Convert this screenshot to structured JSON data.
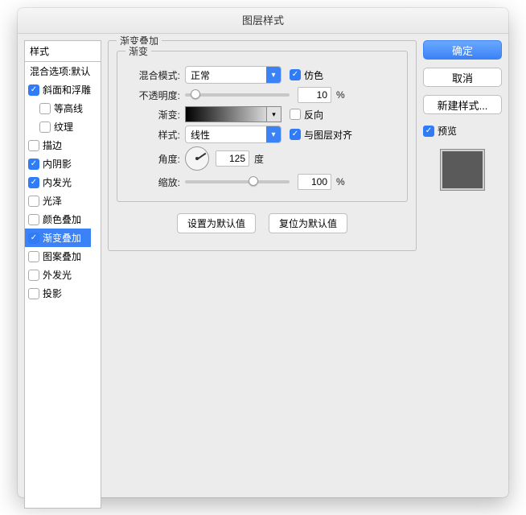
{
  "title": "图层样式",
  "styles_header": "样式",
  "blend_options_label": "混合选项:默认",
  "styles": [
    {
      "key": "bevel",
      "label": "斜面和浮雕",
      "checked": true,
      "indent": false
    },
    {
      "key": "contour",
      "label": "等高线",
      "checked": false,
      "indent": true
    },
    {
      "key": "texture",
      "label": "纹理",
      "checked": false,
      "indent": true
    },
    {
      "key": "stroke",
      "label": "描边",
      "checked": false,
      "indent": false
    },
    {
      "key": "innersh",
      "label": "内阴影",
      "checked": true,
      "indent": false
    },
    {
      "key": "innergl",
      "label": "内发光",
      "checked": true,
      "indent": false
    },
    {
      "key": "satin",
      "label": "光泽",
      "checked": false,
      "indent": false
    },
    {
      "key": "colover",
      "label": "颜色叠加",
      "checked": false,
      "indent": false
    },
    {
      "key": "gradov",
      "label": "渐变叠加",
      "checked": true,
      "indent": false,
      "selected": true
    },
    {
      "key": "patov",
      "label": "图案叠加",
      "checked": false,
      "indent": false
    },
    {
      "key": "outergl",
      "label": "外发光",
      "checked": false,
      "indent": false
    },
    {
      "key": "dropsh",
      "label": "投影",
      "checked": false,
      "indent": false
    }
  ],
  "panel": {
    "legend": "渐变叠加",
    "inner_legend": "渐变",
    "blend_mode_label": "混合模式:",
    "blend_mode_value": "正常",
    "dither_label": "仿色",
    "dither_checked": true,
    "opacity_label": "不透明度:",
    "opacity_value": "10",
    "opacity_unit": "%",
    "opacity_slider_pct": 10,
    "gradient_label": "渐变:",
    "reverse_label": "反向",
    "reverse_checked": false,
    "style_label": "样式:",
    "style_value": "线性",
    "align_label": "与图层对齐",
    "align_checked": true,
    "angle_label": "角度:",
    "angle_value": "125",
    "angle_unit": "度",
    "scale_label": "缩放:",
    "scale_value": "100",
    "scale_unit": "%",
    "scale_slider_pct": 65,
    "default_btn": "设置为默认值",
    "reset_btn": "复位为默认值"
  },
  "right": {
    "ok": "确定",
    "cancel": "取消",
    "new_style": "新建样式...",
    "preview_label": "预览",
    "preview_checked": true
  }
}
